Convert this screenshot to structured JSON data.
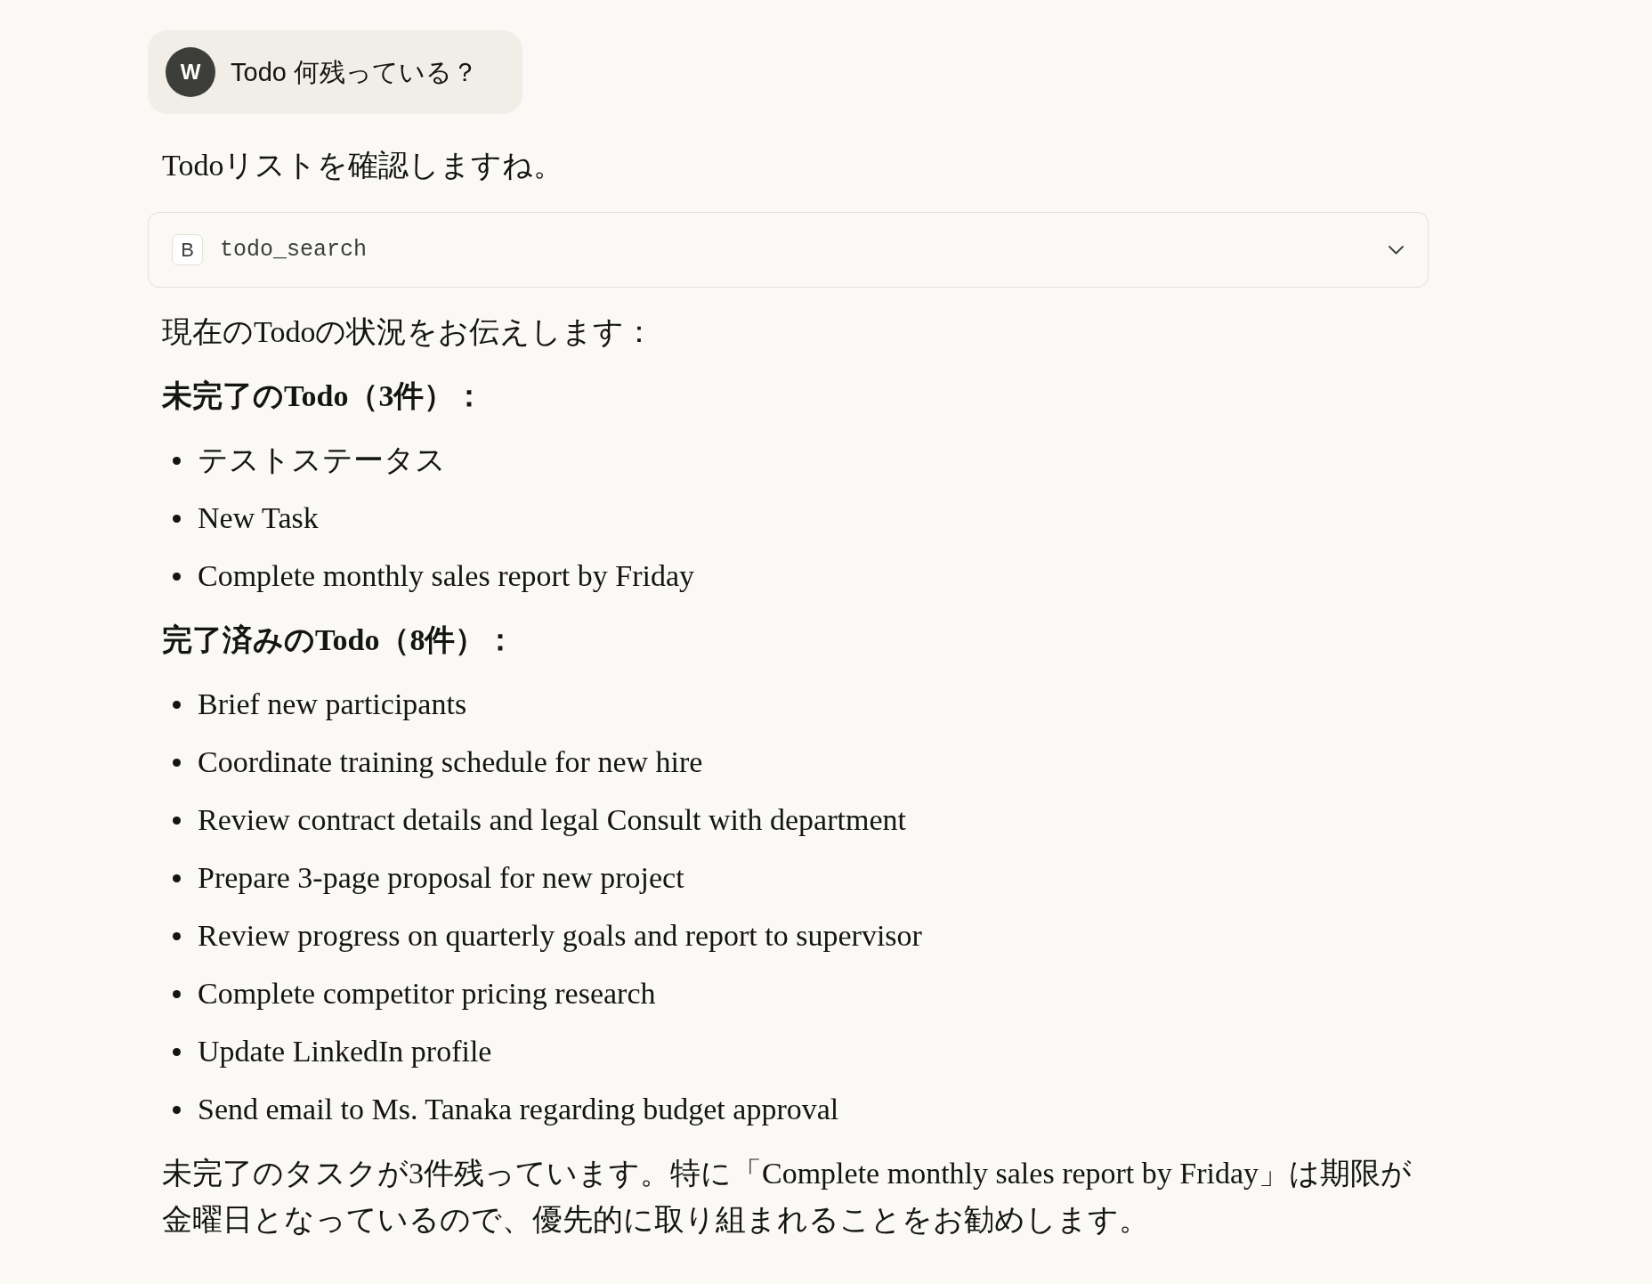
{
  "user_message": {
    "avatar_initial": "W",
    "text": "Todo 何残っている？"
  },
  "assistant": {
    "intro": "Todoリストを確認しますね。",
    "tool_call": {
      "badge": "B",
      "name": "todo_search",
      "expanded": false
    },
    "blocks": [
      {
        "kind": "paragraph",
        "text": "現在のTodoの状況をお伝えします："
      },
      {
        "kind": "heading",
        "text": "未完了のTodo（3件）："
      },
      {
        "kind": "list",
        "items": [
          "テストステータス",
          "New Task",
          "Complete monthly sales report by Friday"
        ]
      },
      {
        "kind": "heading",
        "text": "完了済みのTodo（8件）："
      },
      {
        "kind": "list",
        "items": [
          "Brief new participants",
          "Coordinate training schedule for new hire",
          "Review contract details and legal Consult with department",
          "Prepare 3-page proposal for new project",
          "Review progress on quarterly goals and report to supervisor",
          "Complete competitor pricing research",
          "Update LinkedIn profile",
          "Send email to Ms. Tanaka regarding budget approval"
        ]
      },
      {
        "kind": "paragraph",
        "text": "未完了のタスクが3件残っています。特に「Complete monthly sales report by Friday」は期限が金曜日となっているので、優先的に取り組まれることをお勧めします。"
      }
    ]
  }
}
